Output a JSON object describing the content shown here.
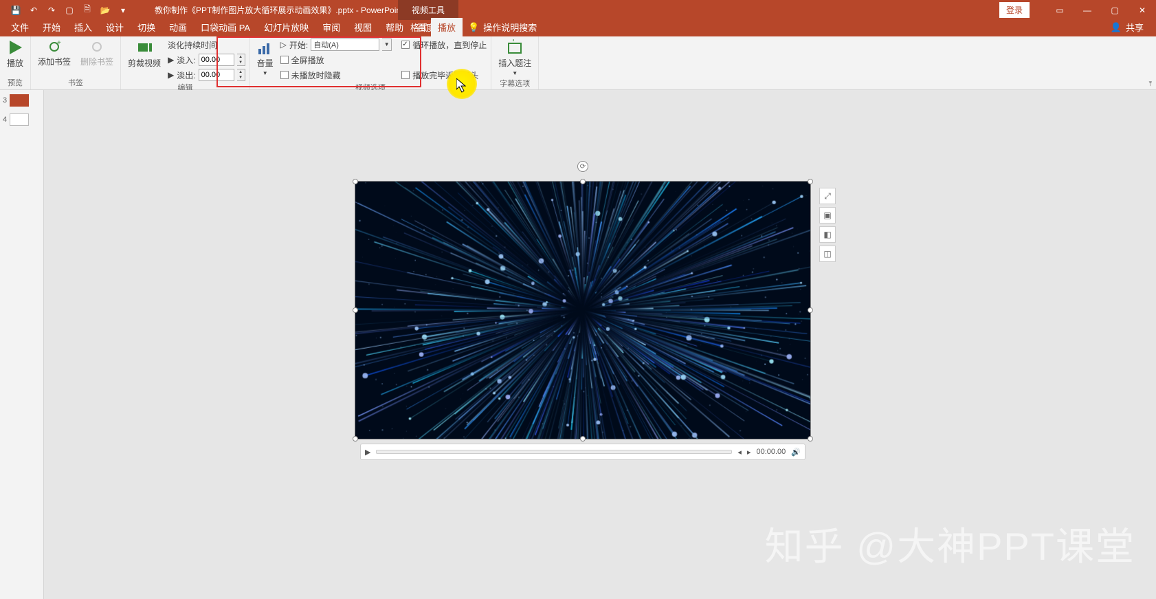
{
  "titlebar": {
    "doc_title": "教你制作《PPT制作图片放大循环展示动画效果》.pptx - PowerPoint",
    "context_tab": "视频工具",
    "login": "登录"
  },
  "tabs": {
    "file": "文件",
    "home": "开始",
    "insert": "插入",
    "design": "设计",
    "transitions": "切换",
    "animations": "动画",
    "koudai": "口袋动画 PA",
    "slideshow": "幻灯片放映",
    "review": "审阅",
    "view": "视图",
    "help": "帮助",
    "baidupan": "百度网盘",
    "format": "格式",
    "playback": "播放",
    "tellme": "操作说明搜索",
    "share": "共享"
  },
  "ribbon": {
    "preview": {
      "play": "播放",
      "label": "预览"
    },
    "bookmarks": {
      "add": "添加书签",
      "remove": "删除书签",
      "label": "书签"
    },
    "editing": {
      "trim": "剪裁视频",
      "fade_title": "淡化持续时间",
      "fade_in": "淡入:",
      "fade_out": "淡出:",
      "fade_in_val": "00.00",
      "fade_out_val": "00.00",
      "label": "编辑"
    },
    "video_options": {
      "volume": "音量",
      "start_label": "开始:",
      "start_value": "自动(A)",
      "fullscreen": "全屏播放",
      "hide": "未播放时隐藏",
      "loop": "循环播放，直到停止",
      "rewind": "播放完毕返回开头",
      "label": "视频选项"
    },
    "captions": {
      "insert_caption": "插入题注",
      "label": "字幕选项"
    }
  },
  "thumbs": {
    "s3": "3",
    "s4": "4"
  },
  "media": {
    "time": "00:00.00"
  },
  "watermark": "知乎 @大神PPT课堂"
}
